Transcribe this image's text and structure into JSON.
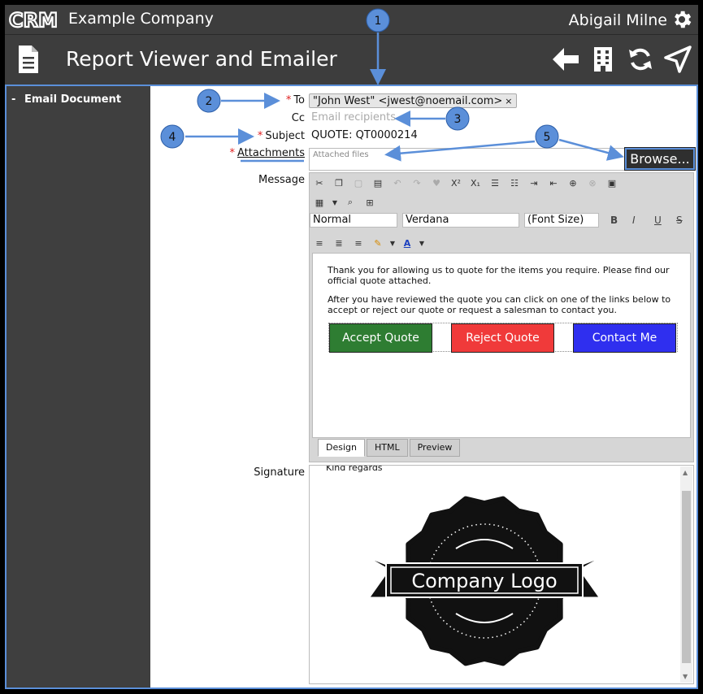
{
  "header": {
    "logo_text": "CRM",
    "company": "Example Company",
    "user": "Abigail Milne"
  },
  "titlebar": {
    "title": "Report Viewer and Emailer"
  },
  "sidebar": {
    "items": [
      {
        "label": "Email Document",
        "expander": "-"
      }
    ]
  },
  "form": {
    "to_label": "To",
    "to_recipient": "\"John West\" <jwest@noemail.com>",
    "to_remove": "×",
    "cc_label": "Cc",
    "cc_placeholder": "Email recipients",
    "subject_label": "Subject",
    "subject_value": "QUOTE: QT0000214",
    "attachments_label": "Attachments",
    "attachments_placeholder": "Attached files",
    "browse_label": "Browse...",
    "message_label": "Message",
    "signature_label": "Signature",
    "required_mark": "*"
  },
  "editor": {
    "style_value": "Normal",
    "font_value": "Verdana",
    "size_value": "(Font Size)",
    "bold": "B",
    "italic": "I",
    "underline": "U",
    "strike": "S",
    "superscript": "X²",
    "subscript": "X₁",
    "font_color": "A",
    "paragraph1": "Thank you for allowing us to quote for the items you require. Please find our official quote attached.",
    "paragraph2": "After you have reviewed the quote you can click on one of the links below to accept or reject our quote or request a salesman to contact you.",
    "buttons": [
      {
        "label": "Accept Quote",
        "color": "#2e7d32"
      },
      {
        "label": "Reject Quote",
        "color": "#f03a3a"
      },
      {
        "label": "Contact Me",
        "color": "#2f2fef"
      }
    ],
    "tabs": [
      "Design",
      "HTML",
      "Preview"
    ]
  },
  "signature": {
    "text": "Kind regards",
    "logo_text": "Company Logo"
  },
  "annotations": [
    "1",
    "2",
    "3",
    "4",
    "5"
  ],
  "colors": {
    "bar": "#3d3d3d",
    "accent": "#5b8fd9",
    "required": "#e02020"
  }
}
